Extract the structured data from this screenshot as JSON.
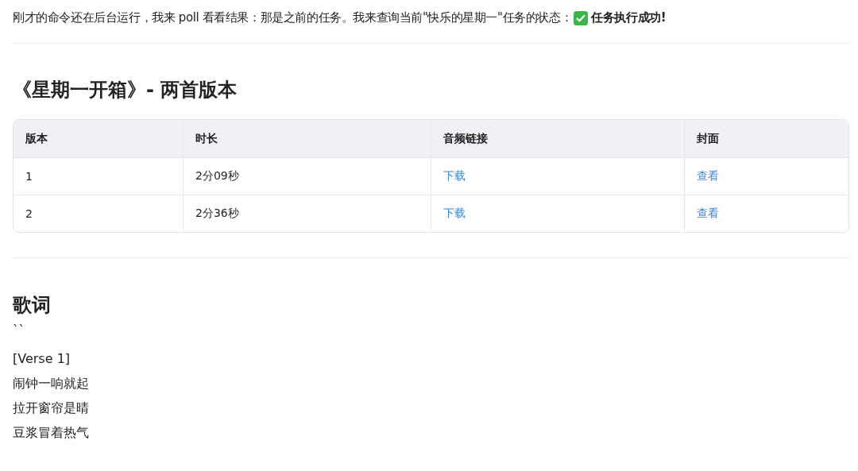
{
  "intro": {
    "text": "刚才的命令还在后台运行，我来 poll 看看结果：那是之前的任务。我来查询当前\"快乐的星期一\"任务的状态：",
    "status": "任务执行成功!"
  },
  "section_title": "《星期一开箱》- 两首版本",
  "table": {
    "columns": [
      "版本",
      "时长",
      "音频链接",
      "封面"
    ],
    "rows": [
      {
        "version": "1",
        "duration": "2分09秒",
        "audio_link": "下载",
        "cover_link": "查看"
      },
      {
        "version": "2",
        "duration": "2分36秒",
        "audio_link": "下载",
        "cover_link": "查看"
      }
    ]
  },
  "lyrics": {
    "title": "歌词",
    "fence": "``",
    "lines": [
      "[Verse 1]",
      "闹钟一响就起",
      "拉开窗帘是晴",
      "豆浆冒着热气"
    ]
  }
}
